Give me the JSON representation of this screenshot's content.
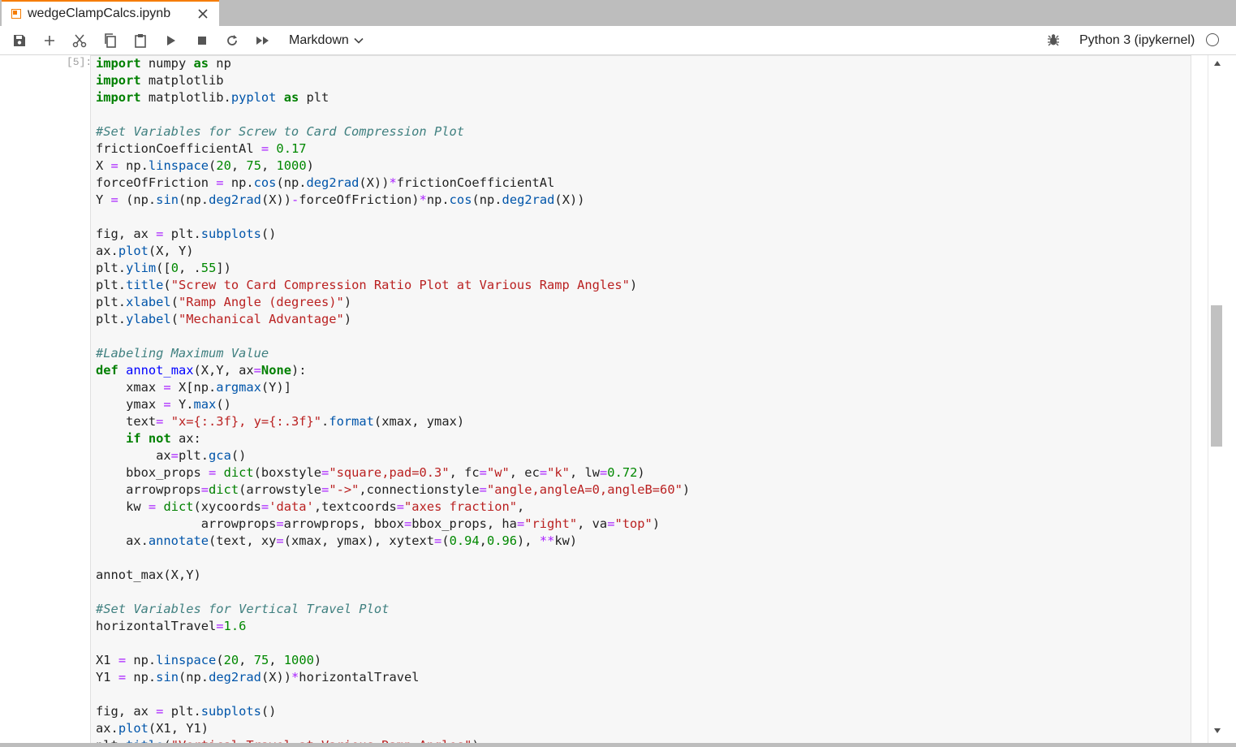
{
  "tab": {
    "title": "wedgeClampCalcs.ipynb"
  },
  "toolbar": {
    "cell_type": "Markdown",
    "kernel_name": "Python 3 (ipykernel)"
  },
  "cell": {
    "prompt": "[5]:",
    "code_lines": [
      "import numpy as np",
      "import matplotlib",
      "import matplotlib.pyplot as plt",
      "",
      "#Set Variables for Screw to Card Compression Plot",
      "frictionCoefficientAl = 0.17",
      "X = np.linspace(20, 75, 1000)",
      "forceOfFriction = np.cos(np.deg2rad(X))*frictionCoefficientAl",
      "Y = (np.sin(np.deg2rad(X))-forceOfFriction)*np.cos(np.deg2rad(X))",
      "",
      "fig, ax = plt.subplots()",
      "ax.plot(X, Y)",
      "plt.ylim([0, .55])",
      "plt.title(\"Screw to Card Compression Ratio Plot at Various Ramp Angles\")",
      "plt.xlabel(\"Ramp Angle (degrees)\")",
      "plt.ylabel(\"Mechanical Advantage\")",
      "",
      "#Labeling Maximum Value",
      "def annot_max(X,Y, ax=None):",
      "    xmax = X[np.argmax(Y)]",
      "    ymax = Y.max()",
      "    text= \"x={:.3f}, y={:.3f}\".format(xmax, ymax)",
      "    if not ax:",
      "        ax=plt.gca()",
      "    bbox_props = dict(boxstyle=\"square,pad=0.3\", fc=\"w\", ec=\"k\", lw=0.72)",
      "    arrowprops=dict(arrowstyle=\"->\",connectionstyle=\"angle,angleA=0,angleB=60\")",
      "    kw = dict(xycoords='data',textcoords=\"axes fraction\",",
      "              arrowprops=arrowprops, bbox=bbox_props, ha=\"right\", va=\"top\")",
      "    ax.annotate(text, xy=(xmax, ymax), xytext=(0.94,0.96), **kw)",
      "",
      "annot_max(X,Y)",
      "",
      "#Set Variables for Vertical Travel Plot",
      "horizontalTravel=1.6",
      "",
      "X1 = np.linspace(20, 75, 1000)",
      "Y1 = np.sin(np.deg2rad(X))*horizontalTravel",
      "",
      "fig, ax = plt.subplots()",
      "ax.plot(X1, Y1)",
      "plt.title(\"Vertical Travel at Various Ramp Angles\")"
    ]
  },
  "icons": {
    "save": "save-icon",
    "add": "plus-icon",
    "cut": "scissors-icon",
    "copy": "copy-icon",
    "paste": "paste-icon",
    "run": "play-icon",
    "stop": "stop-icon",
    "restart": "restart-icon",
    "run_all": "fast-forward-icon",
    "debugger": "bug-icon"
  },
  "colors": {
    "tab_accent": "#f57c00",
    "keyword": "#008000",
    "comment": "#408080",
    "string": "#ba2121"
  }
}
